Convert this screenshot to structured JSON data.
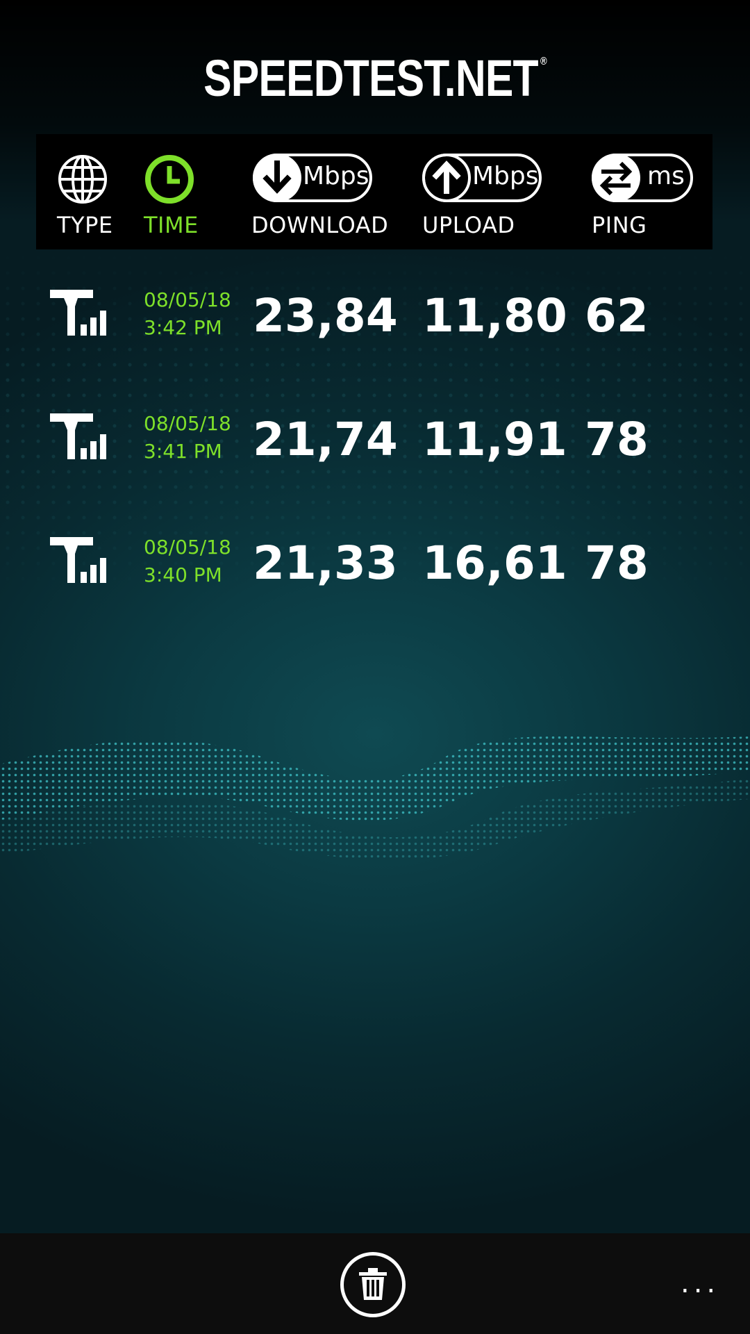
{
  "app": {
    "logo_text": "SPEEDTEST.NET",
    "logo_mark": "®"
  },
  "header": {
    "type": {
      "label": "TYPE",
      "icon": "globe-icon"
    },
    "time": {
      "label": "TIME",
      "icon": "clock-icon",
      "active": true
    },
    "download": {
      "label": "DOWNLOAD",
      "unit": "Mbps",
      "icon": "download-arrow-icon"
    },
    "upload": {
      "label": "UPLOAD",
      "unit": "Mbps",
      "icon": "upload-arrow-icon"
    },
    "ping": {
      "label": "PING",
      "unit": "ms",
      "icon": "ping-arrows-icon"
    }
  },
  "results": [
    {
      "type_icon": "cellular-signal-icon",
      "date": "08/05/18",
      "time": "3:42 PM",
      "download": "23,84",
      "upload": "11,80",
      "ping": "62"
    },
    {
      "type_icon": "cellular-signal-icon",
      "date": "08/05/18",
      "time": "3:41 PM",
      "download": "21,74",
      "upload": "11,91",
      "ping": "78"
    },
    {
      "type_icon": "cellular-signal-icon",
      "date": "08/05/18",
      "time": "3:40 PM",
      "download": "21,33",
      "upload": "16,61",
      "ping": "78"
    }
  ],
  "app_bar": {
    "delete_icon": "trash-icon",
    "more_label": "..."
  },
  "colors": {
    "accent_green": "#7ee02a",
    "background_teal": "#0b3a42",
    "header_bg": "#000000"
  }
}
